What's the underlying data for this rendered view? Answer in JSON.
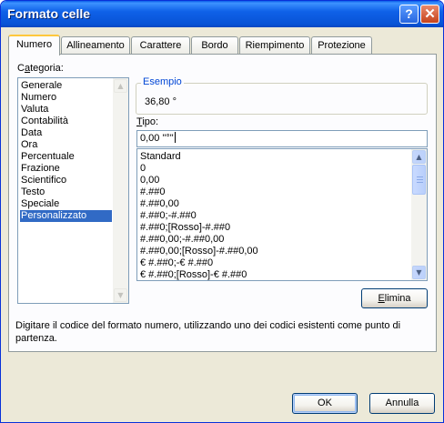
{
  "window": {
    "title": "Formato celle"
  },
  "titlebar_buttons": {
    "help_glyph": "?",
    "close_glyph": "✕"
  },
  "tabs": [
    {
      "label": "Numero",
      "active": true
    },
    {
      "label": "Allineamento",
      "active": false
    },
    {
      "label": "Carattere",
      "active": false
    },
    {
      "label": "Bordo",
      "active": false
    },
    {
      "label": "Riempimento",
      "active": false
    },
    {
      "label": "Protezione",
      "active": false
    }
  ],
  "category": {
    "label_prefix": "C",
    "label_mnemonic": "a",
    "label_suffix": "tegoria:",
    "items": [
      "Generale",
      "Numero",
      "Valuta",
      "Contabilità",
      "Data",
      "Ora",
      "Percentuale",
      "Frazione",
      "Scientifico",
      "Testo",
      "Speciale",
      "Personalizzato"
    ],
    "selected": "Personalizzato"
  },
  "sample": {
    "title": "Esempio",
    "value": "36,80 °"
  },
  "type": {
    "label_mnemonic": "T",
    "label_suffix": "ipo:",
    "value": "0,00 \"°\"",
    "items": [
      "Standard",
      "0",
      "0,00",
      "#.##0",
      "#.##0,00",
      "#.##0;-#.##0",
      "#.##0;[Rosso]-#.##0",
      "#.##0,00;-#.##0,00",
      "#.##0,00;[Rosso]-#.##0,00",
      "€ #.##0;-€ #.##0",
      "€ #.##0;[Rosso]-€ #.##0"
    ]
  },
  "buttons": {
    "delete_mnemonic": "E",
    "delete_suffix": "limina",
    "ok": "OK",
    "cancel": "Annulla"
  },
  "description": {
    "line1": "Digitare il codice del formato numero, utilizzando uno dei codici esistenti come punto di",
    "line2": "partenza."
  },
  "icons": {
    "scroll_up": "up-arrow-icon",
    "scroll_down": "down-arrow-icon"
  },
  "colors": {
    "titlebar": "#0a5ee8",
    "selection": "#316ac5",
    "group_title": "#0046d5",
    "active_tab_accent": "#ffc83c"
  }
}
